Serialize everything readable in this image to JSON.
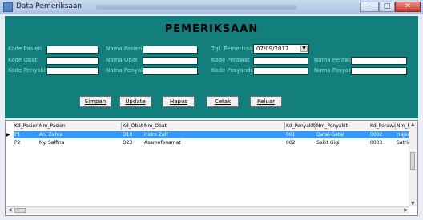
{
  "window": {
    "title": "Data Pemeriksaan",
    "minimize": "–",
    "maximize": "□",
    "close": "✕"
  },
  "form": {
    "heading": "PEMERIKSAAN",
    "labels": {
      "kode_pasien": "Kode Pasien",
      "nama_pasien": "Nama Pasien",
      "tgl_pemeriksaan": "Tgl. Pemeriksaan",
      "kode_obat": "Kode Obat",
      "nama_obat": "Nama Obat",
      "kode_perawat": "Kode Perawat",
      "nama_perawat": "Nama Perawat",
      "kode_penyakit": "Kode Penyakit",
      "nama_penyakit": "Nama Penyakit",
      "kode_posyandu": "Kode Posyandu",
      "nama_posyandu": "Nama Posyandu"
    },
    "values": {
      "kode_pasien": "",
      "nama_pasien": "",
      "tgl_pemeriksaan": "07/09/2017",
      "kode_obat": "",
      "nama_obat": "",
      "kode_perawat": "",
      "nama_perawat": "",
      "kode_penyakit": "",
      "nama_penyakit": "",
      "kode_posyandu": "",
      "nama_posyandu": ""
    },
    "buttons": {
      "simpan": "Simpan",
      "update": "Update",
      "hapus": "Hapus",
      "cetak": "Cetak",
      "keluar": "Keluar"
    }
  },
  "grid": {
    "columns": [
      "Kd_Pasien",
      "Nm_Pasien",
      "Kd_Obat",
      "Nm_Obat",
      "Kd_Penyakit",
      "Nm_Penyakit",
      "Kd_Perawat",
      "Nm_Pe"
    ],
    "rows": [
      [
        "P1",
        "An. Zahra",
        "D10",
        "Hidro Zalf",
        "001",
        "Gatal-Gatal",
        "0002",
        "Hajera"
      ],
      [
        "P2",
        "Ny. Salfina",
        "O23",
        "Asamefenamat",
        "002",
        "Sakit Gigi",
        "0003",
        "Satria"
      ]
    ],
    "selected_row_marker": "▶"
  }
}
